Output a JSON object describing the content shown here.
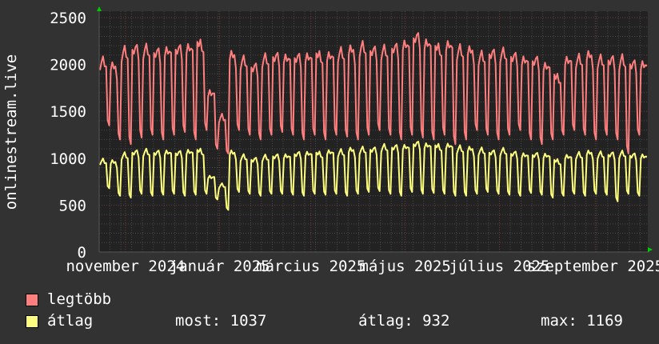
{
  "chart_data": {
    "type": "line",
    "title": "",
    "ylabel": "onlinestream.live",
    "xlabel": "",
    "ylim": [
      0,
      2500
    ],
    "yticks": [
      0,
      500,
      1000,
      1500,
      2000,
      2500
    ],
    "grid": true,
    "x_unit": "week (starting mid-October 2024)",
    "xticks": [
      {
        "label": "november 2024",
        "day": 17
      },
      {
        "label": "január 2025",
        "day": 78
      },
      {
        "label": "március 2025",
        "day": 137
      },
      {
        "label": "május 2025",
        "day": 198
      },
      {
        "label": "július 2025",
        "day": 259
      },
      {
        "label": "szeptember 2025",
        "day": 321
      }
    ],
    "x_days": 355,
    "series": [
      {
        "name": "legtöbb",
        "color": "#ff7f7f",
        "weekday_peak": [
          2050,
          1980,
          2150,
          2200,
          2160,
          2150,
          2180,
          2170,
          2200,
          2240,
          1700,
          1450,
          2100,
          2050,
          2000,
          2060,
          2100,
          2100,
          2080,
          2100,
          2120,
          2100,
          2150,
          2160,
          2200,
          2180,
          2150,
          2200,
          2250,
          2300,
          2250,
          2200,
          2220,
          2180,
          2150,
          2100,
          2150,
          2120,
          2100,
          2080,
          2050,
          2000,
          1880,
          2050,
          2080,
          2100,
          2060,
          2080,
          2050,
          2020,
          2030
        ],
        "weekend_low": [
          1350,
          1200,
          1150,
          1220,
          1250,
          1200,
          1250,
          1280,
          1200,
          1300,
          1100,
          1050,
          1300,
          1250,
          1200,
          1250,
          1280,
          1250,
          1200,
          1250,
          1200,
          1250,
          1230,
          1200,
          1250,
          1300,
          1250,
          1200,
          1250,
          1220,
          1200,
          1250,
          1150,
          1200,
          1300,
          1250,
          1200,
          1250,
          1300,
          1200,
          1150,
          1200,
          1250,
          1300,
          1250,
          1200,
          1250,
          1200,
          1050,
          1250,
          1200
        ]
      },
      {
        "name": "átlag",
        "color": "#ffff7f",
        "weekday_peak": [
          980,
          960,
          1040,
          1080,
          1070,
          1070,
          1080,
          1060,
          1080,
          1090,
          800,
          720,
          1060,
          1020,
          1000,
          1010,
          1030,
          1040,
          1050,
          1060,
          1060,
          1070,
          1080,
          1090,
          1100,
          1110,
          1120,
          1130,
          1140,
          1160,
          1150,
          1140,
          1140,
          1120,
          1100,
          1090,
          1080,
          1080,
          1060,
          1050,
          1040,
          1040,
          980,
          1020,
          1050,
          1060,
          1050,
          1060,
          1050,
          1040,
          1037
        ],
        "weekend_low": [
          680,
          600,
          580,
          620,
          600,
          610,
          620,
          600,
          610,
          620,
          560,
          450,
          640,
          620,
          600,
          620,
          620,
          610,
          600,
          620,
          610,
          620,
          600,
          620,
          640,
          650,
          620,
          600,
          640,
          620,
          630,
          620,
          600,
          600,
          620,
          640,
          620,
          610,
          600,
          630,
          610,
          580,
          600,
          620,
          600,
          620,
          610,
          540,
          620,
          600,
          640
        ]
      }
    ]
  },
  "legend": {
    "max_series_label": "legtöbb",
    "avg_series_label": "átlag",
    "now": "most: 1037",
    "average": "átlag: 932",
    "maximum": "max: 1169"
  }
}
